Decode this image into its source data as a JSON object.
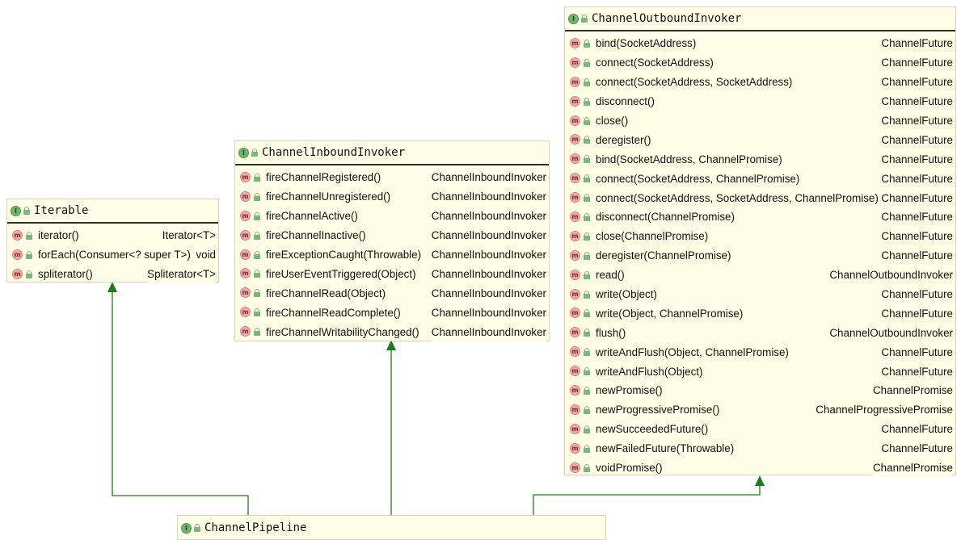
{
  "colors": {
    "box_background": "#fefee6",
    "arrow": "#1b7f1b",
    "interface_icon": "#6db46d",
    "method_icon": "#f2a7a7"
  },
  "icons": {
    "interface": "I",
    "method": "m"
  },
  "iterable": {
    "title": "Iterable",
    "methods": [
      {
        "sig": "iterator()",
        "ret": "Iterator<T>"
      },
      {
        "sig": "forEach(Consumer<? super T>)",
        "ret": "void"
      },
      {
        "sig": "spliterator()",
        "ret": "Spliterator<T>"
      }
    ]
  },
  "inbound": {
    "title": "ChannelInboundInvoker",
    "methods": [
      {
        "sig": "fireChannelRegistered()",
        "ret": "ChannelInboundInvoker"
      },
      {
        "sig": "fireChannelUnregistered()",
        "ret": "ChannelInboundInvoker"
      },
      {
        "sig": "fireChannelActive()",
        "ret": "ChannelInboundInvoker"
      },
      {
        "sig": "fireChannelInactive()",
        "ret": "ChannelInboundInvoker"
      },
      {
        "sig": "fireExceptionCaught(Throwable)",
        "ret": "ChannelInboundInvoker"
      },
      {
        "sig": "fireUserEventTriggered(Object)",
        "ret": "ChannelInboundInvoker"
      },
      {
        "sig": "fireChannelRead(Object)",
        "ret": "ChannelInboundInvoker"
      },
      {
        "sig": "fireChannelReadComplete()",
        "ret": "ChannelInboundInvoker"
      },
      {
        "sig": "fireChannelWritabilityChanged()",
        "ret": "ChannelInboundInvoker"
      }
    ]
  },
  "outbound": {
    "title": "ChannelOutboundInvoker",
    "methods": [
      {
        "sig": "bind(SocketAddress)",
        "ret": "ChannelFuture"
      },
      {
        "sig": "connect(SocketAddress)",
        "ret": "ChannelFuture"
      },
      {
        "sig": "connect(SocketAddress, SocketAddress)",
        "ret": "ChannelFuture"
      },
      {
        "sig": "disconnect()",
        "ret": "ChannelFuture"
      },
      {
        "sig": "close()",
        "ret": "ChannelFuture"
      },
      {
        "sig": "deregister()",
        "ret": "ChannelFuture"
      },
      {
        "sig": "bind(SocketAddress, ChannelPromise)",
        "ret": "ChannelFuture"
      },
      {
        "sig": "connect(SocketAddress, ChannelPromise)",
        "ret": "ChannelFuture"
      },
      {
        "sig": "connect(SocketAddress, SocketAddress, ChannelPromise)",
        "ret": "ChannelFuture"
      },
      {
        "sig": "disconnect(ChannelPromise)",
        "ret": "ChannelFuture"
      },
      {
        "sig": "close(ChannelPromise)",
        "ret": "ChannelFuture"
      },
      {
        "sig": "deregister(ChannelPromise)",
        "ret": "ChannelFuture"
      },
      {
        "sig": "read()",
        "ret": "ChannelOutboundInvoker"
      },
      {
        "sig": "write(Object)",
        "ret": "ChannelFuture"
      },
      {
        "sig": "write(Object, ChannelPromise)",
        "ret": "ChannelFuture"
      },
      {
        "sig": "flush()",
        "ret": "ChannelOutboundInvoker"
      },
      {
        "sig": "writeAndFlush(Object, ChannelPromise)",
        "ret": "ChannelFuture"
      },
      {
        "sig": "writeAndFlush(Object)",
        "ret": "ChannelFuture"
      },
      {
        "sig": "newPromise()",
        "ret": "ChannelPromise"
      },
      {
        "sig": "newProgressivePromise()",
        "ret": "ChannelProgressivePromise"
      },
      {
        "sig": "newSucceededFuture()",
        "ret": "ChannelFuture"
      },
      {
        "sig": "newFailedFuture(Throwable)",
        "ret": "ChannelFuture"
      },
      {
        "sig": "voidPromise()",
        "ret": "ChannelPromise"
      }
    ]
  },
  "pipeline": {
    "title": "ChannelPipeline"
  }
}
